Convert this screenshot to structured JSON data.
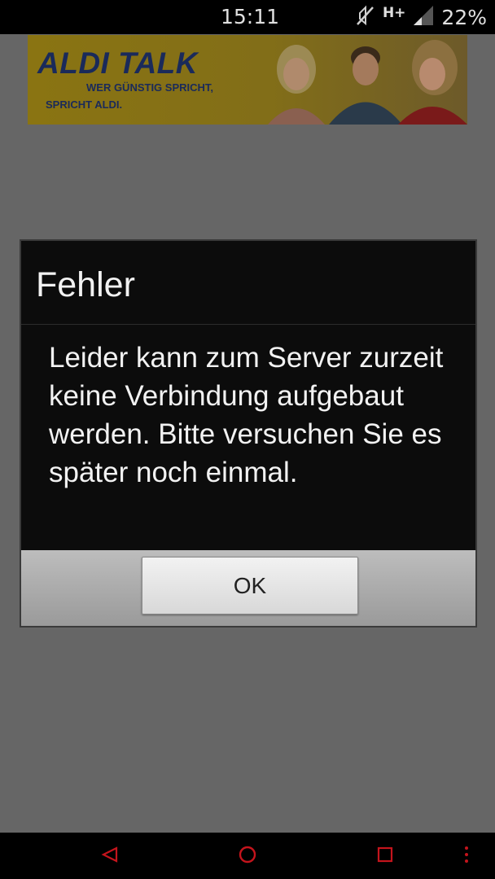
{
  "status_bar": {
    "time": "15:11",
    "network": "H+",
    "battery": "22%",
    "icons": [
      "mute-icon",
      "signal-icon"
    ]
  },
  "ad_banner": {
    "title": "ALDI TALK",
    "tagline_line1": "WER GÜNSTIG SPRICHT,",
    "tagline_line2": "SPRICHT ALDI."
  },
  "dialog": {
    "title": "Fehler",
    "message": "Leider kann zum Server zurzeit keine Verbindung aufgebaut werden. Bitte versuchen Sie es später noch einmal.",
    "ok_label": "OK"
  },
  "nav_bar": {
    "icons": [
      "back-icon",
      "home-icon",
      "recents-icon",
      "menu-icon"
    ],
    "accent_color": "#c4141c"
  }
}
